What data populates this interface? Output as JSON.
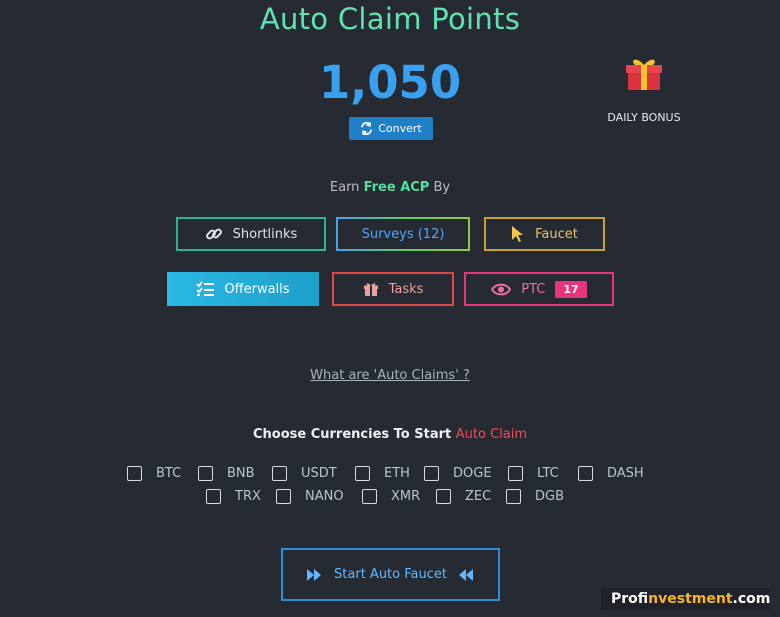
{
  "header": {
    "title": "Auto Claim Points"
  },
  "balance": {
    "points": "1,050",
    "convert_label": "Convert"
  },
  "bonus": {
    "icon": "gift-icon",
    "label": "DAILY BONUS"
  },
  "earn": {
    "prefix": "Earn",
    "highlight": "Free ACP",
    "suffix": "By"
  },
  "earn_buttons": {
    "shortlinks": "Shortlinks",
    "surveys": "Surveys (12)",
    "faucet": "Faucet",
    "offerwalls": "Offerwalls",
    "tasks": "Tasks",
    "ptc": "PTC",
    "ptc_count": "17"
  },
  "help_link": "What are 'Auto Claims' ?",
  "currencies": {
    "heading": "Choose Currencies To Start",
    "heading_accent": "Auto Claim",
    "items": [
      "BTC",
      "BNB",
      "USDT",
      "ETH",
      "DOGE",
      "LTC",
      "DASH",
      "TRX",
      "NANO",
      "XMR",
      "ZEC",
      "DGB"
    ],
    "checked": []
  },
  "start_button": {
    "label": "Start Auto Faucet"
  },
  "watermark": {
    "part1": "Prof",
    "part2": "investment",
    "part3": ".com"
  },
  "colors": {
    "accent_green": "#5fe3ae",
    "accent_blue": "#3aa0f0",
    "accent_red": "#ef4c5a",
    "ptc_pink": "#e8337e"
  }
}
